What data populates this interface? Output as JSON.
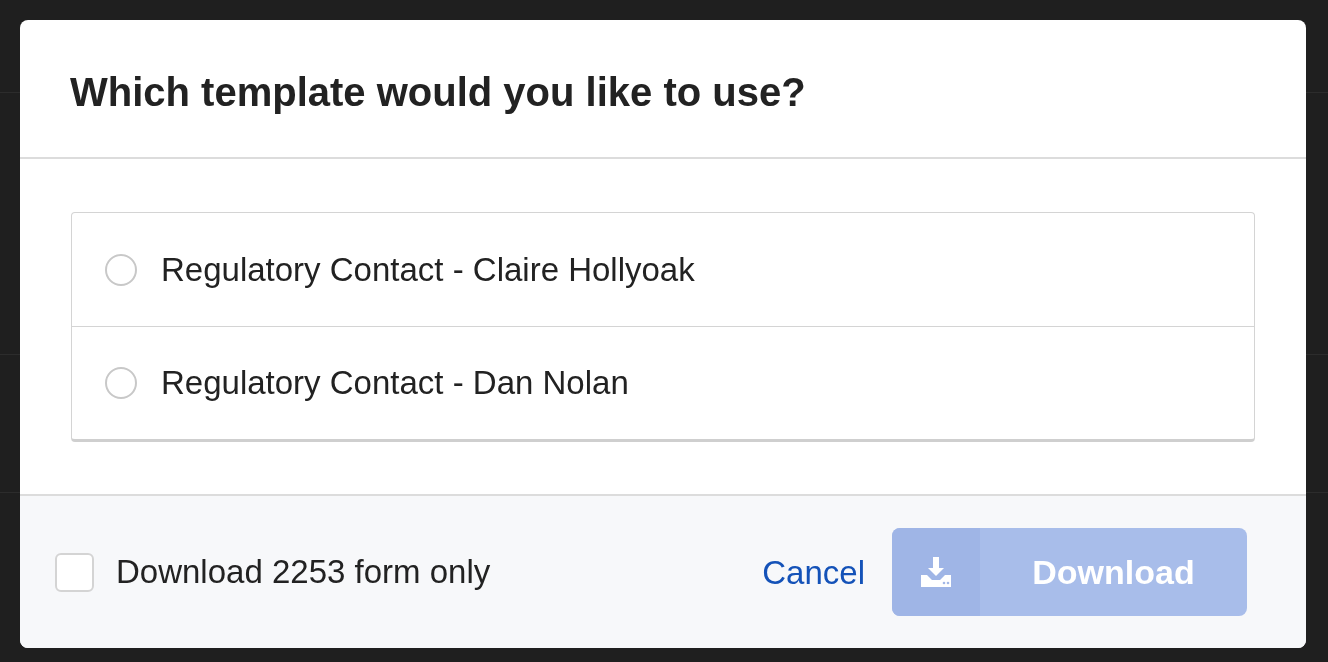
{
  "dialog": {
    "title": "Which template would you like to use?",
    "options": [
      {
        "label": "Regulatory Contact - Claire Hollyoak",
        "selected": false
      },
      {
        "label": "Regulatory Contact - Dan Nolan",
        "selected": false
      }
    ],
    "footer": {
      "checkbox": {
        "label": "Download 2253 form only",
        "checked": false
      },
      "cancel": "Cancel",
      "download": {
        "label": "Download",
        "disabled": true
      }
    }
  }
}
